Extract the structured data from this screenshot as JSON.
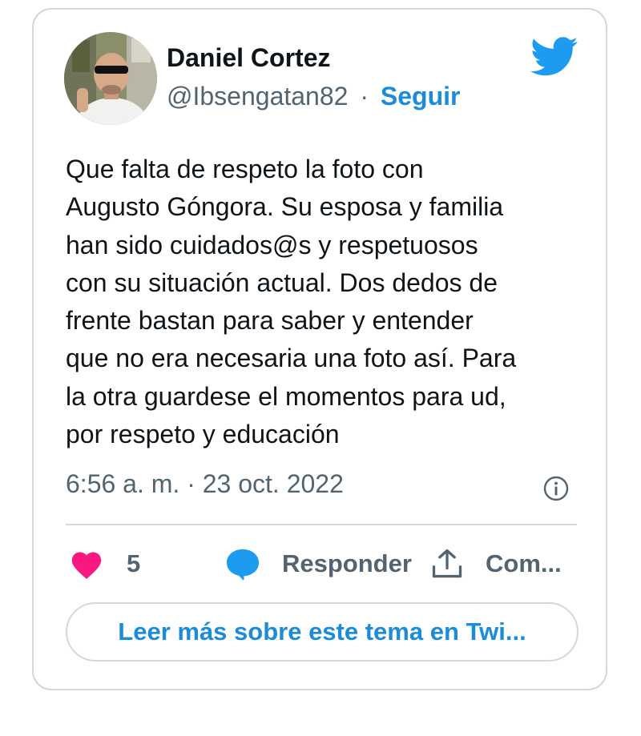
{
  "tweet": {
    "author_name": "Daniel Cortez",
    "handle": "@Ibsengatan82",
    "separator": "·",
    "follow_label": "Seguir",
    "text": "Que falta de respeto la foto con\nAugusto Góngora. Su esposa y familia\nhan sido cuidados@s y respetuosos\ncon su situación actual. Dos dedos de\nfrente bastan para saber y entender\nque no era necesaria una foto así. Para\nla otra guardese el momentos para ud,\npor respeto y educación",
    "timestamp": "6:56 a. m. · 23 oct. 2022"
  },
  "actions": {
    "like_count": "5",
    "reply_label": "Responder",
    "share_label": "Com..."
  },
  "read_more_label": "Leer más sobre este tema en Twi...",
  "icons": {
    "brand": "twitter-bird-icon",
    "info": "info-icon",
    "like": "heart-icon",
    "reply": "speech-bubble-icon",
    "share": "share-upload-icon"
  },
  "colors": {
    "twitter_blue": "#1d9bf0",
    "link_blue": "#1a8cd8",
    "heart_pink": "#f91880",
    "secondary_text": "#536471",
    "border": "#cfd9de"
  }
}
